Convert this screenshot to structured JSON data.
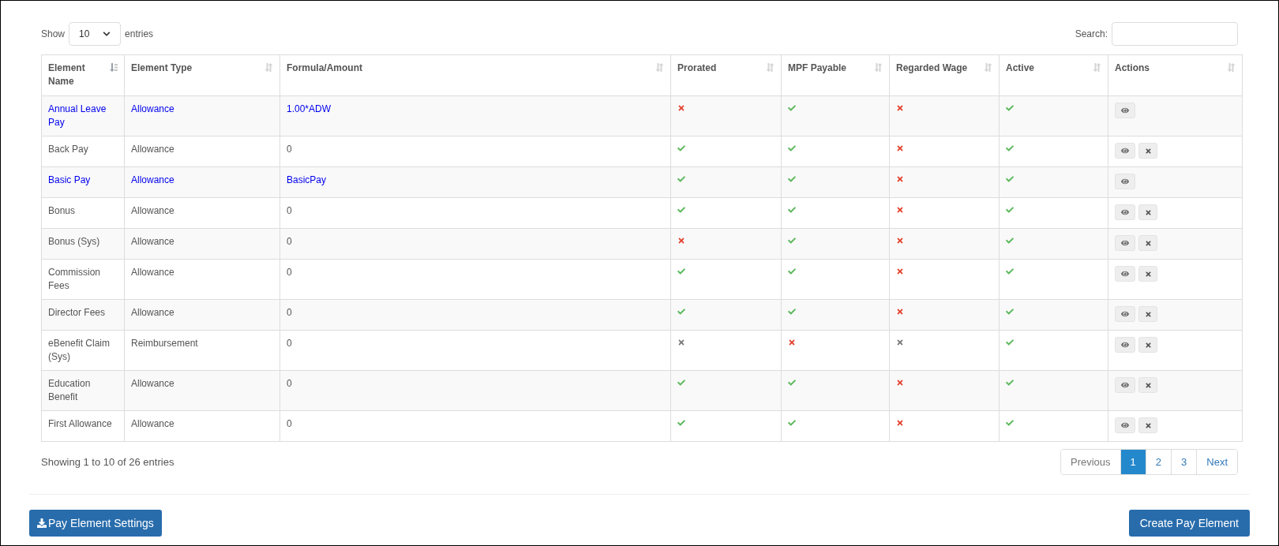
{
  "length_menu": {
    "label_before": "Show",
    "value": "10",
    "label_after": "entries"
  },
  "search": {
    "label": "Search:"
  },
  "table": {
    "columns": [
      {
        "label": "Element Name",
        "sorted": true
      },
      {
        "label": "Element Type",
        "sorted": false
      },
      {
        "label": "Formula/Amount",
        "sorted": false
      },
      {
        "label": "Prorated",
        "sorted": false
      },
      {
        "label": "MPF Payable",
        "sorted": false
      },
      {
        "label": "Regarded Wage",
        "sorted": false
      },
      {
        "label": "Active",
        "sorted": false
      },
      {
        "label": "Actions",
        "sorted": false
      }
    ],
    "rows": [
      {
        "name": "Annual Leave Pay",
        "type": "Allowance",
        "formula": "1.00*ADW",
        "highlighted": true,
        "flags": [
          {
            "on": false,
            "disabled": false
          },
          {
            "on": true,
            "disabled": false
          },
          {
            "on": false,
            "disabled": false
          },
          {
            "on": true,
            "disabled": false
          }
        ],
        "deletable": false
      },
      {
        "name": "Back Pay",
        "type": "Allowance",
        "formula": "0",
        "highlighted": false,
        "flags": [
          {
            "on": true,
            "disabled": false
          },
          {
            "on": true,
            "disabled": false
          },
          {
            "on": false,
            "disabled": false
          },
          {
            "on": true,
            "disabled": false
          }
        ],
        "deletable": true
      },
      {
        "name": "Basic Pay",
        "type": "Allowance",
        "formula": "BasicPay",
        "highlighted": true,
        "flags": [
          {
            "on": true,
            "disabled": false
          },
          {
            "on": true,
            "disabled": false
          },
          {
            "on": false,
            "disabled": false
          },
          {
            "on": true,
            "disabled": false
          }
        ],
        "deletable": false
      },
      {
        "name": "Bonus",
        "type": "Allowance",
        "formula": "0",
        "highlighted": false,
        "flags": [
          {
            "on": true,
            "disabled": false
          },
          {
            "on": true,
            "disabled": false
          },
          {
            "on": false,
            "disabled": false
          },
          {
            "on": true,
            "disabled": false
          }
        ],
        "deletable": true
      },
      {
        "name": "Bonus (Sys)",
        "type": "Allowance",
        "formula": "0",
        "highlighted": false,
        "flags": [
          {
            "on": false,
            "disabled": false
          },
          {
            "on": true,
            "disabled": false
          },
          {
            "on": false,
            "disabled": false
          },
          {
            "on": true,
            "disabled": false
          }
        ],
        "deletable": true
      },
      {
        "name": "Commission Fees",
        "type": "Allowance",
        "formula": "0",
        "highlighted": false,
        "flags": [
          {
            "on": true,
            "disabled": false
          },
          {
            "on": true,
            "disabled": false
          },
          {
            "on": false,
            "disabled": false
          },
          {
            "on": true,
            "disabled": false
          }
        ],
        "deletable": true
      },
      {
        "name": "Director Fees",
        "type": "Allowance",
        "formula": "0",
        "highlighted": false,
        "flags": [
          {
            "on": true,
            "disabled": false
          },
          {
            "on": true,
            "disabled": false
          },
          {
            "on": false,
            "disabled": false
          },
          {
            "on": true,
            "disabled": false
          }
        ],
        "deletable": true
      },
      {
        "name": "eBenefit Claim (Sys)",
        "type": "Reimbursement",
        "formula": "0",
        "highlighted": false,
        "flags": [
          {
            "on": false,
            "disabled": true
          },
          {
            "on": false,
            "disabled": false
          },
          {
            "on": false,
            "disabled": true
          },
          {
            "on": true,
            "disabled": false
          }
        ],
        "deletable": true
      },
      {
        "name": "Education Benefit",
        "type": "Allowance",
        "formula": "0",
        "highlighted": false,
        "flags": [
          {
            "on": true,
            "disabled": false
          },
          {
            "on": true,
            "disabled": false
          },
          {
            "on": false,
            "disabled": false
          },
          {
            "on": true,
            "disabled": false
          }
        ],
        "deletable": true
      },
      {
        "name": "First Allowance",
        "type": "Allowance",
        "formula": "0",
        "highlighted": false,
        "flags": [
          {
            "on": true,
            "disabled": false
          },
          {
            "on": true,
            "disabled": false
          },
          {
            "on": false,
            "disabled": false
          },
          {
            "on": true,
            "disabled": false
          }
        ],
        "deletable": true
      }
    ]
  },
  "info": "Showing 1 to 10 of 26 entries",
  "pagination": [
    {
      "label": "Previous",
      "selected": false
    },
    {
      "label": "1",
      "selected": true
    },
    {
      "label": "2",
      "selected": false
    },
    {
      "label": "3",
      "selected": false
    },
    {
      "label": "Next",
      "selected": false
    }
  ],
  "buttons": {
    "settings": "Pay Element Settings",
    "create": "Create Pay Element"
  }
}
